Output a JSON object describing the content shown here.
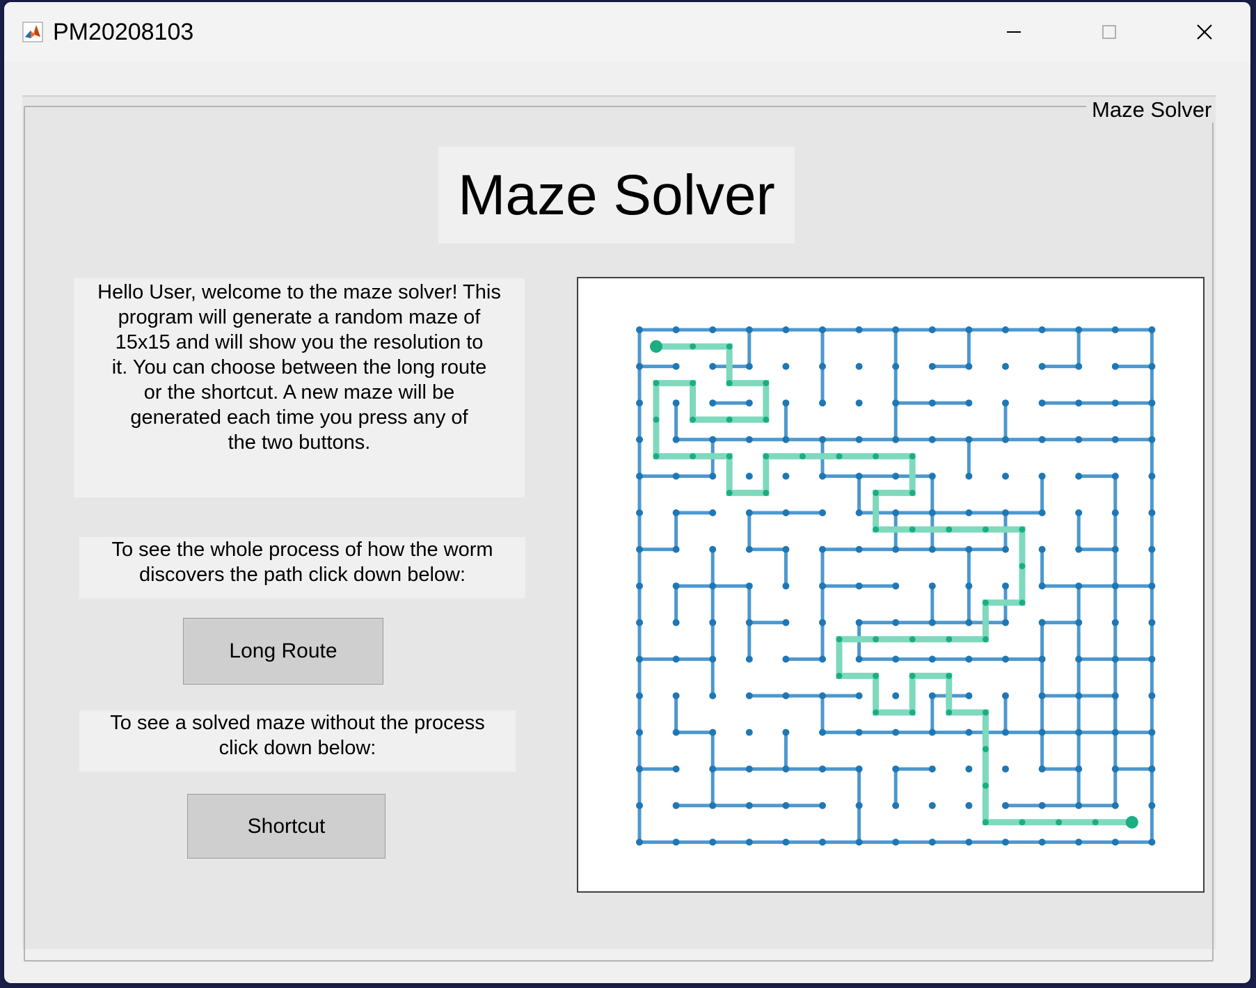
{
  "window": {
    "title": "PM20208103",
    "app_icon": "matlab-icon",
    "controls": [
      "minimize-icon",
      "maximize-icon",
      "close-icon"
    ]
  },
  "panel": {
    "title": "Maze Solver"
  },
  "heading": "Maze Solver",
  "welcome_lines": [
    "Hello User, welcome to the maze solver! This",
    "program will generate a random maze of",
    "15x15 and will show you the resolution to",
    "it. You can choose between the long route",
    "or the shortcut. A new maze will be",
    "generated each time you press any of",
    "the two buttons."
  ],
  "long_info_lines": [
    "To see the whole process of how the worm",
    "discovers the path click down below:"
  ],
  "long_button": "Long Route",
  "short_info_lines": [
    "To see a  solved maze without the process",
    "click down below:"
  ],
  "short_button": "Shortcut",
  "colors": {
    "maze": "#4d98cf",
    "maze_node": "#1f77b4",
    "path": "#7ed9bd",
    "path_node": "#1aae82"
  },
  "maze": {
    "grid_size": 15,
    "h_segments": [
      [
        0,
        0,
        14
      ],
      [
        0,
        1,
        1
      ],
      [
        2,
        1,
        3
      ],
      [
        8,
        1,
        9
      ],
      [
        11,
        1,
        12
      ],
      [
        13,
        1,
        14
      ],
      [
        2,
        2,
        3
      ],
      [
        7,
        2,
        9
      ],
      [
        11,
        2,
        14
      ],
      [
        1,
        3,
        14
      ],
      [
        0,
        4,
        2
      ],
      [
        5,
        4,
        8
      ],
      [
        12,
        4,
        13
      ],
      [
        1,
        5,
        2
      ],
      [
        3,
        5,
        5
      ],
      [
        6,
        5,
        11
      ],
      [
        0,
        6,
        1
      ],
      [
        3,
        6,
        4
      ],
      [
        5,
        6,
        10
      ],
      [
        12,
        6,
        13
      ],
      [
        1,
        7,
        3
      ],
      [
        5,
        7,
        7
      ],
      [
        11,
        7,
        14
      ],
      [
        3,
        8,
        4
      ],
      [
        6,
        8,
        10
      ],
      [
        11,
        8,
        12
      ],
      [
        0,
        9,
        2
      ],
      [
        4,
        9,
        5
      ],
      [
        6,
        9,
        11
      ],
      [
        12,
        9,
        14
      ],
      [
        3,
        10,
        6
      ],
      [
        8,
        10,
        9
      ],
      [
        11,
        10,
        13
      ],
      [
        1,
        11,
        2
      ],
      [
        5,
        11,
        10
      ],
      [
        10,
        11,
        14
      ],
      [
        0,
        12,
        1
      ],
      [
        2,
        12,
        6
      ],
      [
        7,
        12,
        8
      ],
      [
        11,
        12,
        12
      ],
      [
        13,
        12,
        14
      ],
      [
        1,
        13,
        5
      ],
      [
        10,
        13,
        13
      ],
      [
        0,
        14,
        14
      ]
    ],
    "v_segments": [
      [
        0,
        0,
        14
      ],
      [
        14,
        0,
        14
      ],
      [
        3,
        0,
        1
      ],
      [
        5,
        0,
        2
      ],
      [
        7,
        0,
        3
      ],
      [
        9,
        0,
        1
      ],
      [
        12,
        0,
        1
      ],
      [
        1,
        2,
        3
      ],
      [
        4,
        2,
        3
      ],
      [
        10,
        2,
        3
      ],
      [
        2,
        3,
        4
      ],
      [
        5,
        3,
        4
      ],
      [
        9,
        3,
        4
      ],
      [
        6,
        4,
        5
      ],
      [
        8,
        4,
        6
      ],
      [
        11,
        4,
        5
      ],
      [
        13,
        4,
        13
      ],
      [
        1,
        5,
        6
      ],
      [
        3,
        5,
        6
      ],
      [
        7,
        5,
        6
      ],
      [
        10,
        5,
        6
      ],
      [
        12,
        5,
        6
      ],
      [
        2,
        6,
        10
      ],
      [
        4,
        6,
        7
      ],
      [
        5,
        6,
        9
      ],
      [
        9,
        6,
        8
      ],
      [
        11,
        6,
        7
      ],
      [
        1,
        7,
        8
      ],
      [
        3,
        7,
        9
      ],
      [
        8,
        7,
        8
      ],
      [
        10,
        7,
        8
      ],
      [
        12,
        7,
        11
      ],
      [
        6,
        8,
        9
      ],
      [
        11,
        8,
        12
      ],
      [
        1,
        10,
        11
      ],
      [
        4,
        11,
        12
      ],
      [
        5,
        10,
        11
      ],
      [
        8,
        10,
        11
      ],
      [
        10,
        10,
        11
      ],
      [
        13,
        10,
        11
      ],
      [
        2,
        11,
        13
      ],
      [
        6,
        12,
        14
      ],
      [
        7,
        12,
        13
      ],
      [
        12,
        11,
        13
      ]
    ],
    "solution_path": [
      [
        0,
        0
      ],
      [
        2,
        0
      ],
      [
        2,
        1
      ],
      [
        3,
        1
      ],
      [
        3,
        2
      ],
      [
        1,
        2
      ],
      [
        1,
        1
      ],
      [
        0,
        1
      ],
      [
        0,
        3
      ],
      [
        2,
        3
      ],
      [
        2,
        4
      ],
      [
        3,
        4
      ],
      [
        3,
        3
      ],
      [
        7,
        3
      ],
      [
        7,
        4
      ],
      [
        6,
        4
      ],
      [
        6,
        5
      ],
      [
        10,
        5
      ],
      [
        10,
        7
      ],
      [
        9,
        7
      ],
      [
        9,
        8
      ],
      [
        5,
        8
      ],
      [
        5,
        9
      ],
      [
        6,
        9
      ],
      [
        6,
        10
      ],
      [
        7,
        10
      ],
      [
        7,
        9
      ],
      [
        8,
        9
      ],
      [
        8,
        10
      ],
      [
        9,
        10
      ],
      [
        9,
        13
      ],
      [
        13,
        13
      ]
    ]
  }
}
